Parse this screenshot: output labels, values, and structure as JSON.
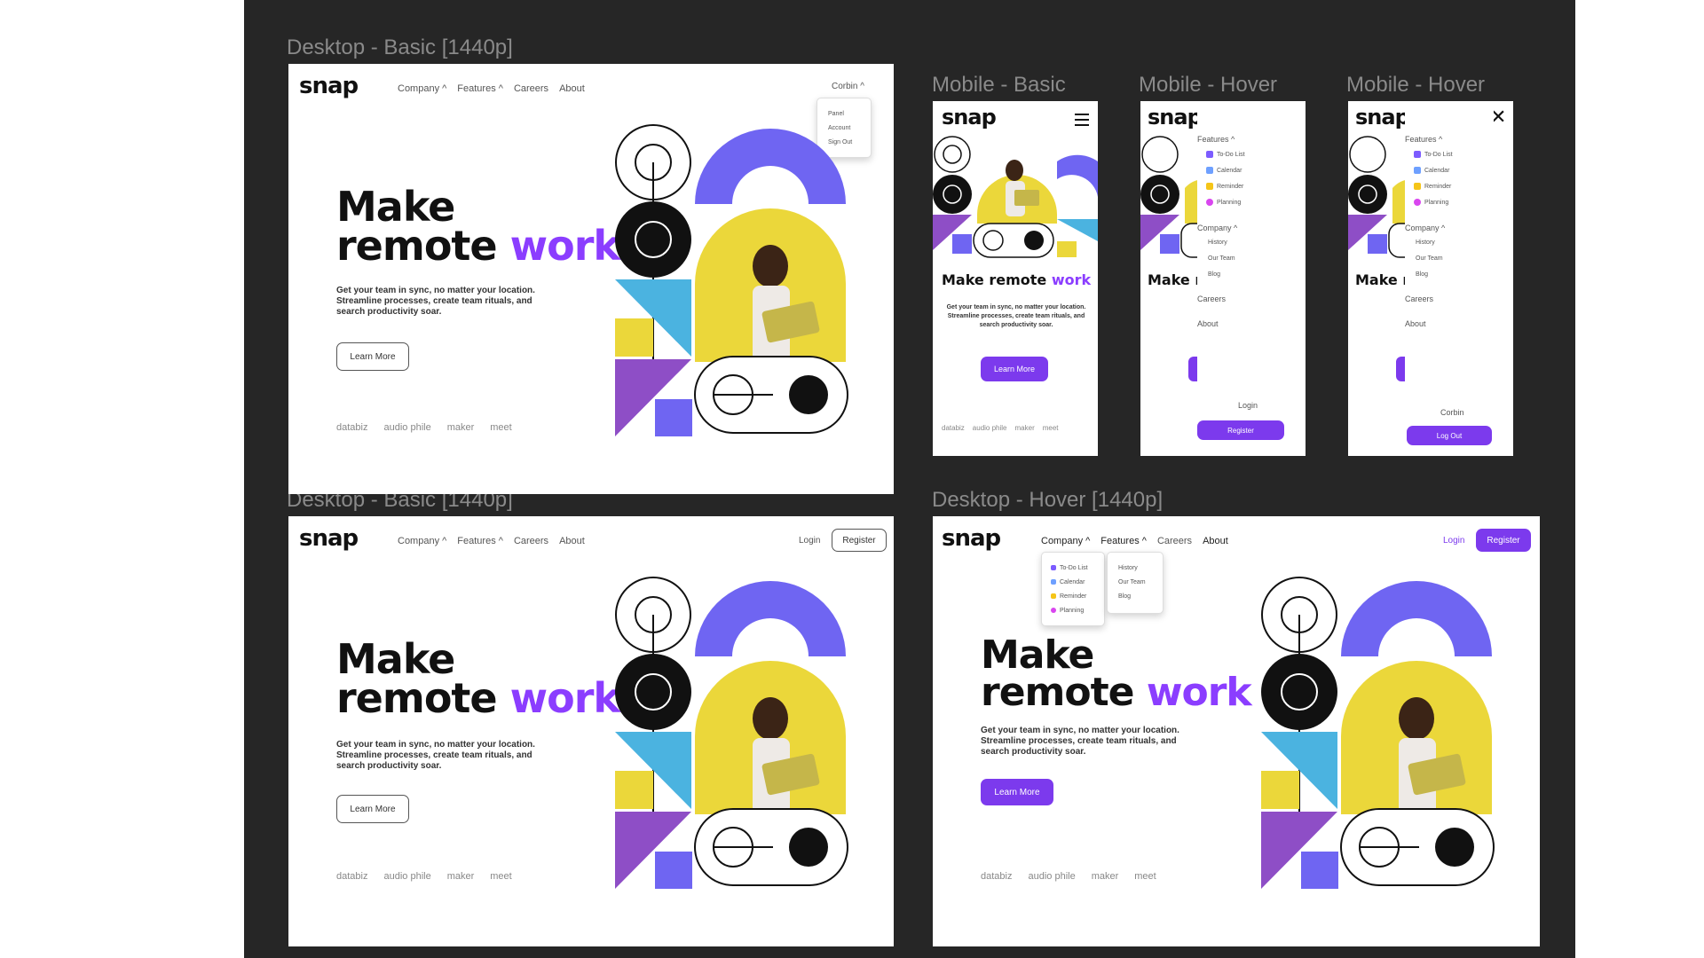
{
  "frame_labels": {
    "desktop_basic_top": "Desktop - Basic [1440p]",
    "mobile_basic": "Mobile - Basic",
    "mobile_hover_1": "Mobile - Hover",
    "mobile_hover_2": "Mobile - Hover",
    "desktop_basic_bottom": "Desktop - Basic [1440p]",
    "desktop_hover": "Desktop - Hover [1440p]"
  },
  "site": {
    "logo": "snap",
    "nav": {
      "company": "Company ^",
      "features": "Features ^",
      "careers": "Careers",
      "about": "About"
    },
    "login": "Login",
    "register": "Register",
    "hero_line1": "Make",
    "hero_line2a": "remote ",
    "hero_line2b": "work",
    "mobile_hero_a": "Make remote ",
    "mobile_hero_b": "work",
    "mobile_hero_cut": "Make r",
    "description": "Get your team in sync, no matter your location. Streamline processes, create team rituals, and watch productivity soar.",
    "description_lines": [
      "Get your team in sync, no matter your location.",
      "Streamline processes, create team rituals, and",
      "search productivity soar."
    ],
    "learn_more": "Learn More",
    "brands": [
      "databiz",
      "audio phile",
      "maker",
      "meet"
    ]
  },
  "user_menu": {
    "user": "Corbin ^",
    "items": [
      "Panel",
      "Account",
      "Sign Out"
    ]
  },
  "features_menu": {
    "title": "Features ^",
    "items": [
      "To-Do List",
      "Calendar",
      "Reminder",
      "Planning"
    ],
    "colors": [
      "#7c5cff",
      "#6ea0ff",
      "#f5c518",
      "#d946ef"
    ]
  },
  "company_menu": {
    "title": "Company ^",
    "items": [
      "History",
      "Our Team",
      "Blog"
    ]
  },
  "mobile_menu": {
    "careers": "Careers",
    "about": "About",
    "login": "Login",
    "register": "Register",
    "user": "Corbin",
    "logout": "Log Out"
  },
  "colors": {
    "purple": "#8b3dff",
    "button_purple": "#7c3aed",
    "yellow": "#ebd73a",
    "blue": "#4bb3e0",
    "violet": "#6f65f2",
    "canvas": "#262626"
  }
}
